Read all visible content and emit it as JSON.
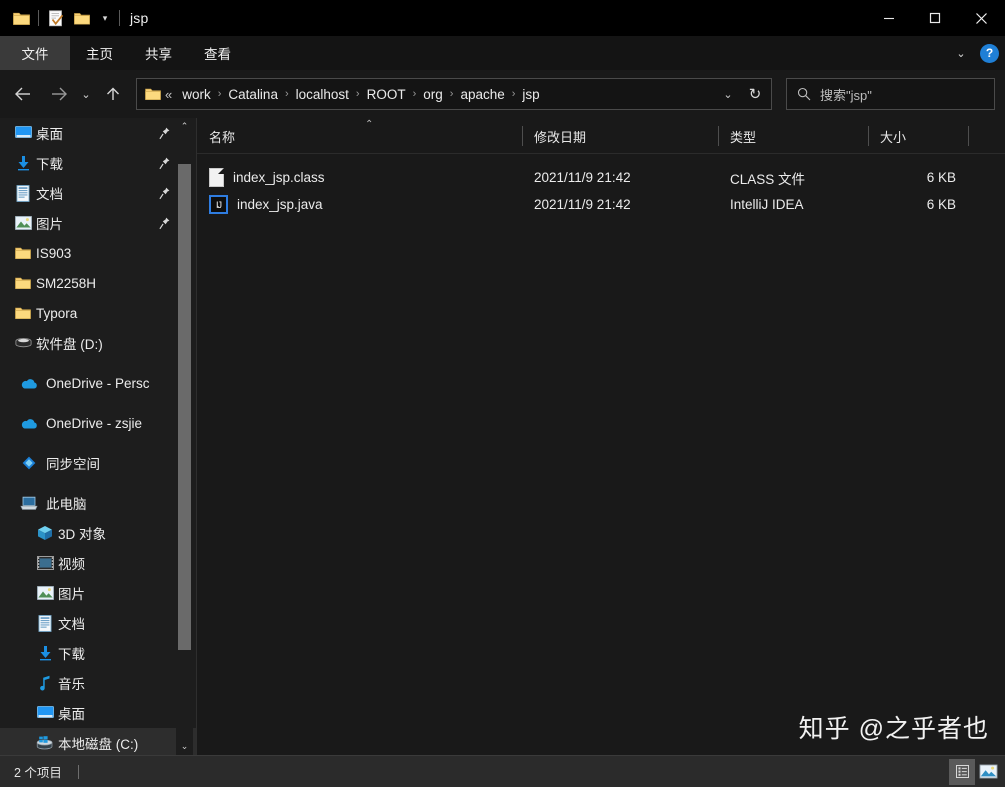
{
  "window": {
    "title": "jsp",
    "quick_access": [
      {
        "name": "folder-icon",
        "label": "文件资源管理器"
      },
      {
        "name": "properties-icon",
        "label": "属性"
      },
      {
        "name": "new-folder-icon",
        "label": "新建文件夹"
      }
    ],
    "controls": {
      "minimize": "—",
      "maximize": "□",
      "close": "✕"
    }
  },
  "ribbon": {
    "tabs": [
      {
        "label": "文件",
        "selected": true
      },
      {
        "label": "主页",
        "selected": false
      },
      {
        "label": "共享",
        "selected": false
      },
      {
        "label": "查看",
        "selected": false
      }
    ],
    "collapse_caret": "⌄",
    "help_label": "?"
  },
  "nav": {
    "back": "←",
    "forward": "→",
    "recent": "⌄",
    "up": "↑",
    "refresh": "↻",
    "address_chevron": "⌄",
    "breadcrumb_ellipsis": "«",
    "breadcrumb": [
      "work",
      "Catalina",
      "localhost",
      "ROOT",
      "org",
      "apache",
      "jsp"
    ],
    "separator": "›"
  },
  "search": {
    "placeholder": "搜索\"jsp\"",
    "icon": "search-icon"
  },
  "sidebar": {
    "scroll_up": "⌃",
    "scroll_down": "⌄",
    "pin_glyph": "📌",
    "quick_access": [
      {
        "label": "桌面",
        "icon": "desktop-icon",
        "pinned": true
      },
      {
        "label": "下载",
        "icon": "downloads-icon",
        "pinned": true
      },
      {
        "label": "文档",
        "icon": "documents-icon",
        "pinned": true
      },
      {
        "label": "图片",
        "icon": "pictures-icon",
        "pinned": true
      },
      {
        "label": "IS903",
        "icon": "folder-icon",
        "pinned": false
      },
      {
        "label": "SM2258H",
        "icon": "folder-icon",
        "pinned": false
      },
      {
        "label": "Typora",
        "icon": "folder-icon",
        "pinned": false
      },
      {
        "label": "软件盘 (D:)",
        "icon": "drive-icon",
        "pinned": false
      }
    ],
    "cloud": [
      {
        "label": "OneDrive - Persc",
        "icon": "onedrive-icon"
      },
      {
        "label": "OneDrive - zsjie",
        "icon": "onedrive-icon"
      },
      {
        "label": "同步空间",
        "icon": "sync-icon"
      }
    ],
    "this_pc": {
      "label": "此电脑",
      "icon": "this-pc-icon",
      "children": [
        {
          "label": "3D 对象",
          "icon": "3d-objects-icon"
        },
        {
          "label": "视频",
          "icon": "videos-icon"
        },
        {
          "label": "图片",
          "icon": "pictures-icon"
        },
        {
          "label": "文档",
          "icon": "documents-icon"
        },
        {
          "label": "下载",
          "icon": "downloads-icon"
        },
        {
          "label": "音乐",
          "icon": "music-icon"
        },
        {
          "label": "桌面",
          "icon": "desktop-icon"
        },
        {
          "label": "本地磁盘 (C:)",
          "icon": "local-disk-icon"
        }
      ]
    }
  },
  "filelist": {
    "columns": [
      {
        "label": "名称",
        "sorted": true,
        "sort_caret": "⌃"
      },
      {
        "label": "修改日期",
        "sorted": false
      },
      {
        "label": "类型",
        "sorted": false
      },
      {
        "label": "大小",
        "sorted": false
      }
    ],
    "rows": [
      {
        "name": "index_jsp.class",
        "date": "2021/11/9 21:42",
        "type": "CLASS 文件",
        "size": "6 KB",
        "icon": "class-file-icon"
      },
      {
        "name": "index_jsp.java",
        "date": "2021/11/9 21:42",
        "type": "IntelliJ IDEA",
        "size": "6 KB",
        "icon": "intellij-idea-file-icon",
        "icon_text": "IJ"
      }
    ]
  },
  "status": {
    "item_count": "2 个项目",
    "views": [
      {
        "name": "details-view-button",
        "active": true
      },
      {
        "name": "large-icons-view-button",
        "active": false
      }
    ]
  },
  "watermark": {
    "text": "知乎 @之乎者也"
  },
  "colors": {
    "window_bg": "#191919",
    "titlebar_bg": "#000000",
    "sidebar_bg": "#1d1d1d",
    "statusbar_bg": "#2b2b2b",
    "accent_blue": "#1f7fd6",
    "folder_yellow": "#f6c76a",
    "selected_tab": "#3a3a3a"
  }
}
